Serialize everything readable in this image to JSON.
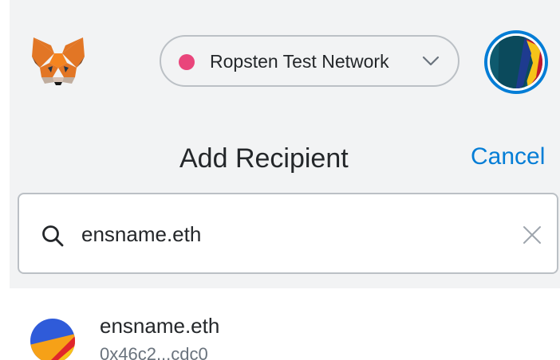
{
  "app": {
    "logo_icon": "metamask-fox-icon",
    "network": {
      "label": "Ropsten Test Network",
      "dot_color": "#e9457b",
      "chevron_icon": "chevron-down-icon"
    },
    "account_avatar_icon": "identicon-avatar"
  },
  "header": {
    "title": "Add Recipient",
    "cancel_label": "Cancel",
    "accent_color": "#037dd6"
  },
  "search": {
    "icon": "search-icon",
    "value": "ensname.eth",
    "clear_icon": "close-icon"
  },
  "results": [
    {
      "name": "ensname.eth",
      "address": "0x46c2...cdc0",
      "avatar_icon": "identicon-avatar"
    }
  ]
}
